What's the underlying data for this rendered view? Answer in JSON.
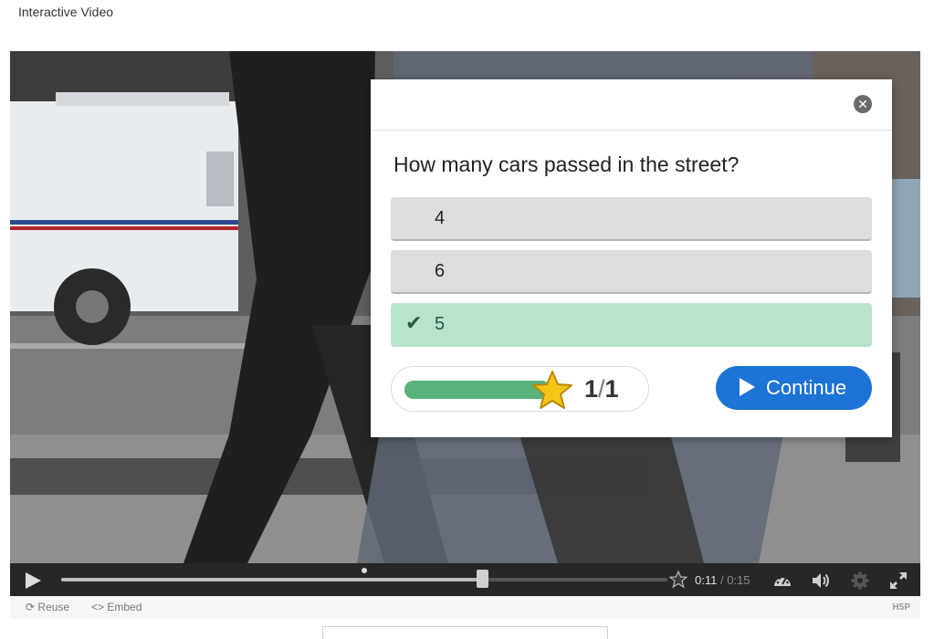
{
  "page": {
    "title": "Interactive Video"
  },
  "dialog": {
    "question": "How many cars passed in the street?",
    "answers": [
      {
        "label": "4",
        "correct": false
      },
      {
        "label": "6",
        "correct": false
      },
      {
        "label": "5",
        "correct": true
      }
    ],
    "score": {
      "earned": "1",
      "separator": "/",
      "max": "1",
      "progress": 1.0
    },
    "continue_label": "Continue"
  },
  "controls": {
    "current_time": "0:11",
    "time_separator": " / ",
    "total_time": "0:15",
    "progress": 0.695,
    "interaction_marker": 0.5
  },
  "footer": {
    "reuse_label": "Reuse",
    "embed_label": "Embed",
    "logo": "H5P"
  },
  "icons": {
    "close": "close-icon",
    "check": "check-icon",
    "star": "star-icon",
    "play": "play-icon",
    "speed": "speed-icon",
    "volume": "volume-icon",
    "settings": "gear-icon",
    "fullscreen": "fullscreen-icon",
    "reuse": "reuse-icon",
    "embed": "embed-icon"
  },
  "colors": {
    "continue_button": "#1d73d6",
    "correct_answer": "#b8e4cc",
    "score_bar": "#58b27a",
    "star": "#f5c518"
  }
}
